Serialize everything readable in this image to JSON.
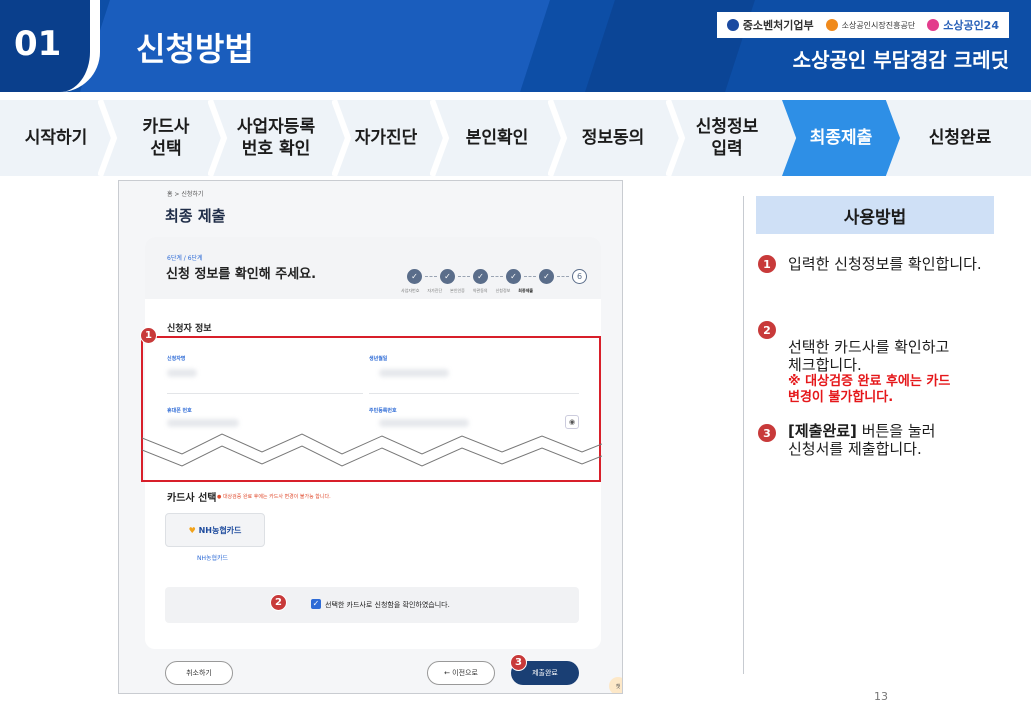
{
  "header": {
    "number": "01",
    "title": "신청방법",
    "subtitle": "소상공인 부담경감 크레딧",
    "logos": [
      "중소벤처기업부",
      "소상공인시장진흥공단",
      "소상공인24"
    ]
  },
  "steps": [
    {
      "label": "시작하기",
      "active": false
    },
    {
      "label": "카드사\n선택",
      "active": false
    },
    {
      "label": "사업자등록\n번호 확인",
      "active": false
    },
    {
      "label": "자가진단",
      "active": false
    },
    {
      "label": "본인확인",
      "active": false
    },
    {
      "label": "정보동의",
      "active": false
    },
    {
      "label": "신청정보\n입력",
      "active": false
    },
    {
      "label": "최종제출",
      "active": true
    },
    {
      "label": "신청완료",
      "active": false
    }
  ],
  "screen": {
    "breadcrumb": "홈 > 신청하기",
    "page_title": "최종 제출",
    "step_indicator": "6단계 / 6단계",
    "question": "신청 정보를 확인해 주세요.",
    "progress_labels": [
      "사업자번호",
      "자가진단",
      "본인인증",
      "약관동의",
      "신청정보",
      "최종제출"
    ],
    "current_step": "6",
    "section_title": "신청자 정보",
    "fields": {
      "name_label": "신청자명",
      "birth_label": "생년월일",
      "phone_label": "휴대폰 번호",
      "rrn_label": "주민등록번호"
    },
    "card_select_title": "카드사 선택",
    "card_select_warning": "● 대상검증 완료 후에는 카드사 변경이 불가능 합니다.",
    "card_option_name": "NH농협카드",
    "card_option_label": "NH농협카드",
    "confirm_text": "선택한 카드사로 신청함을 확인하였습니다.",
    "buttons": {
      "cancel": "취소하기",
      "prev": "← 이전으로",
      "submit": "제출완료"
    },
    "chatbot": "챗"
  },
  "badges": [
    "1",
    "2",
    "3"
  ],
  "usage": {
    "title": "사용방법",
    "items": [
      {
        "num": "1",
        "text": "입력한 신청정보를 확인합니다."
      },
      {
        "num": "2",
        "text": "선택한 카드사를 확인하고\n체크합니다.",
        "note": "※ 대상검증 완료 후에는 카드\n변경이 불가합니다."
      },
      {
        "num": "3",
        "text_bold": "[제출완료]",
        "text": " 버튼을 눌러\n신청서를 제출합니다."
      }
    ]
  },
  "page_number": "13",
  "colors": {
    "header_bg": "#0d4ea6",
    "active_step": "#2e8fe6",
    "highlight": "#d81f2a",
    "badge": "#c83a3a"
  }
}
